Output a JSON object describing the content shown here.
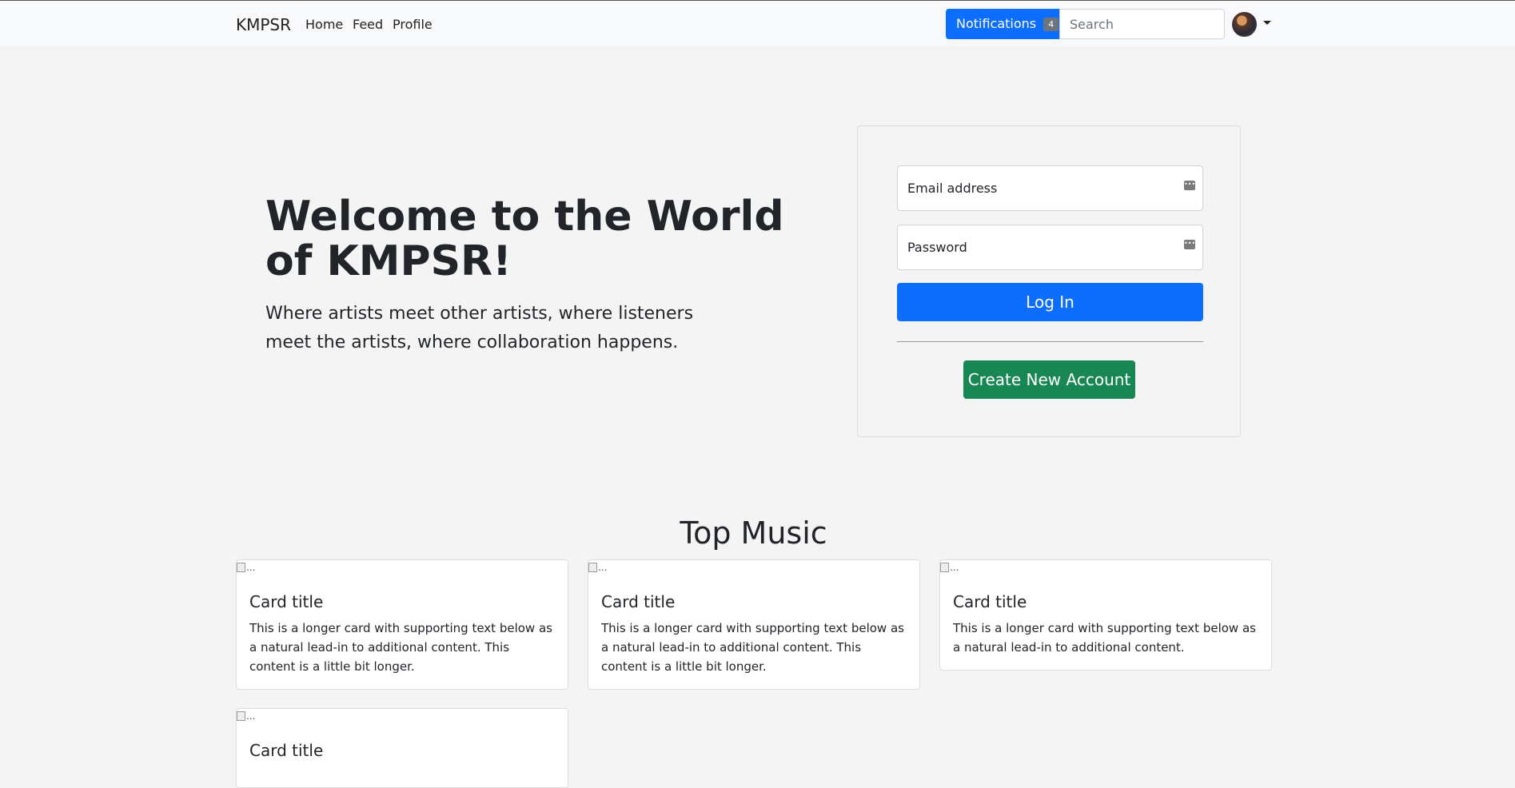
{
  "navbar": {
    "brand": "KMPSR",
    "links": [
      "Home",
      "Feed",
      "Profile"
    ],
    "notifications_label": "Notifications",
    "notifications_count": "4",
    "search_placeholder": "Search"
  },
  "hero": {
    "title": "Welcome to the World of KMPSR!",
    "subtitle": "Where artists meet other artists, where listeners meet the artists, where collaboration happens."
  },
  "login": {
    "email_placeholder": "Email address",
    "password_placeholder": "Password",
    "login_label": "Log In",
    "create_label": "Create New Account"
  },
  "section": {
    "title": "Top Music"
  },
  "cards": [
    {
      "img_alt": "...",
      "title": "Card title",
      "text": "This is a longer card with supporting text below as a natural lead-in to additional content. This content is a little bit longer."
    },
    {
      "img_alt": "...",
      "title": "Card title",
      "text": "This is a longer card with supporting text below as a natural lead-in to additional content. This content is a little bit longer."
    },
    {
      "img_alt": "...",
      "title": "Card title",
      "text": "This is a longer card with supporting text below as a natural lead-in to additional content."
    },
    {
      "img_alt": "...",
      "title": "Card title",
      "text": ""
    }
  ]
}
